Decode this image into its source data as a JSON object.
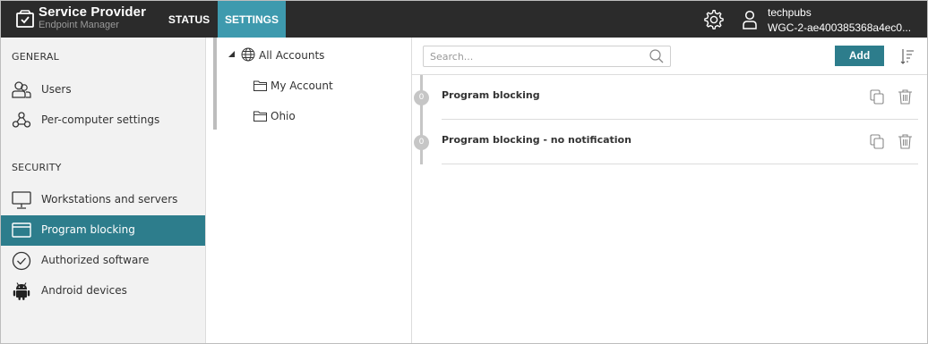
{
  "header": {
    "brand_title": "Service Provider",
    "brand_subtitle": "Endpoint Manager",
    "tabs": [
      {
        "label": "STATUS",
        "active": false
      },
      {
        "label": "SETTINGS",
        "active": true
      }
    ],
    "user": {
      "name": "techpubs",
      "org": "WGC-2-ae400385368a4ec0..."
    },
    "accent_color": "#3e9aae"
  },
  "sidebar": {
    "general_heading": "GENERAL",
    "security_heading": "SECURITY",
    "items": [
      {
        "label": "Users",
        "icon": "users-icon",
        "active": false
      },
      {
        "label": "Per-computer settings",
        "icon": "network-icon",
        "active": false
      },
      {
        "label": "Workstations and servers",
        "icon": "monitor-icon",
        "active": false
      },
      {
        "label": "Program blocking",
        "icon": "window-icon",
        "active": true
      },
      {
        "label": "Authorized software",
        "icon": "check-circle-icon",
        "active": false
      },
      {
        "label": "Android devices",
        "icon": "android-icon",
        "active": false
      }
    ],
    "active_color": "#2d7d8c"
  },
  "tree": {
    "root": {
      "label": "All Accounts",
      "icon": "globe-icon",
      "expanded": true
    },
    "children": [
      {
        "label": "My Account",
        "icon": "folder-icon"
      },
      {
        "label": "Ohio",
        "icon": "folder-icon"
      }
    ]
  },
  "main": {
    "search_placeholder": "Search...",
    "add_label": "Add",
    "policies": [
      {
        "title": "Program blocking",
        "badge": "0"
      },
      {
        "title": "Program blocking - no notification",
        "badge": "0"
      }
    ]
  }
}
